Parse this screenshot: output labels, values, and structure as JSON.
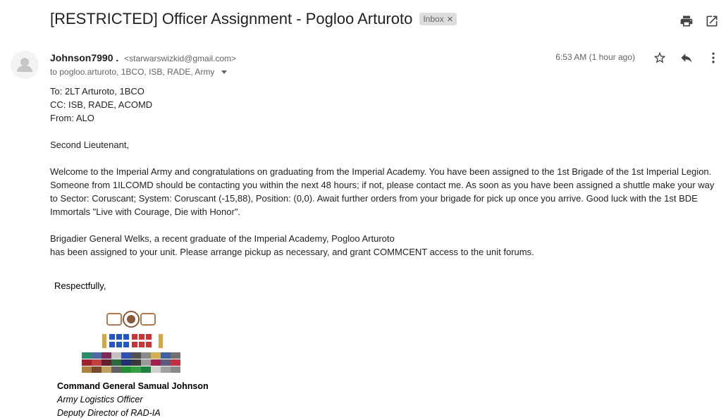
{
  "subject": "[RESTRICTED] Officer Assignment - Pogloo Arturoto",
  "label": "Inbox",
  "sender": {
    "name": "Johnson7990 .",
    "email": "<starwarswizkid@gmail.com>",
    "to_line": "to pogloo.arturoto, 1BCO, ISB, RADE, Army"
  },
  "time": "6:53 AM (1 hour ago)",
  "icons": {
    "print": "print-icon",
    "open_new": "open-in-new-window-icon",
    "star": "star-icon",
    "reply": "reply-icon",
    "more": "more-vertical-icon",
    "avatar": "person-icon"
  },
  "body": {
    "to": "To: 2LT Arturoto, 1BCO",
    "cc": "CC: ISB, RADE, ACOMD",
    "from": "From: ALO",
    "greeting": "Second Lieutenant,",
    "paragraph1": "Welcome to the Imperial Army and congratulations on graduating from the Imperial Academy. You have been assigned to the 1st Brigade of the 1st Imperial Legion. Someone from 1ILCOMD should be contacting you within the next 48 hours; if not, please contact me. As soon as you have been assigned a shuttle make your way to Sector: Coruscant; System: Coruscant (-15,88), Position: (0,0). Await further orders from your brigade for pick up once you arrive. Good luck with the 1st BDE Immortals \"Live with Courage, Die with Honor\".",
    "paragraph2_line1": "Brigadier General Welks, a recent graduate of the Imperial Academy,  Pogloo Arturoto",
    "paragraph2_line2": "has been assigned to your unit. Please arrange pickup as necessary, and grant COMMCENT access to the unit forums."
  },
  "signature": {
    "closing": "Respectfully,",
    "name": "Command General Samual Johnson",
    "role1": "Army Logistics Officer",
    "role2": "Deputy Director of RAD-IA"
  }
}
